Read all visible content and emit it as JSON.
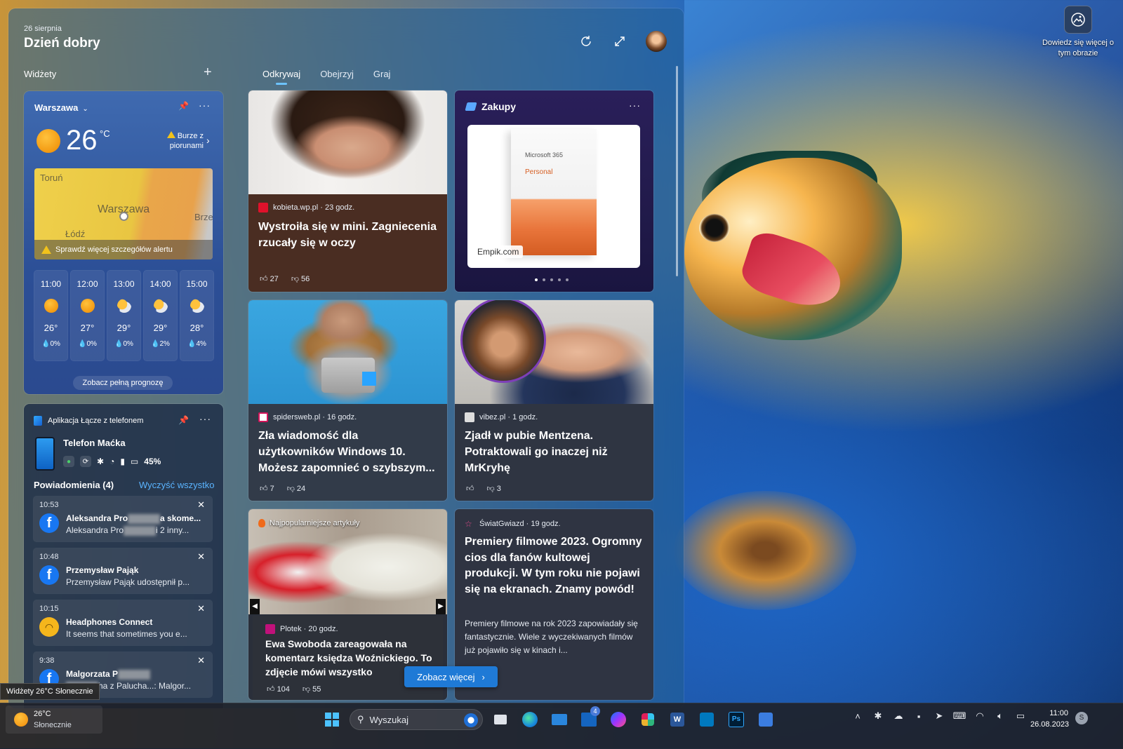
{
  "panel": {
    "date": "26 sierpnia",
    "greeting": "Dzień dobry",
    "widgets_label": "Widżety",
    "add_icon": "plus-icon",
    "tabs": [
      {
        "label": "Odkrywaj",
        "active": true
      },
      {
        "label": "Obejrzyj",
        "active": false
      },
      {
        "label": "Graj",
        "active": false
      }
    ]
  },
  "background": {
    "learn_more": "Dowiedz się więcej o tym obrazie"
  },
  "weather": {
    "city": "Warszawa",
    "temp": "26",
    "unit": "°C",
    "alert": "Burze z piorunami",
    "map_towns": [
      "Toruń",
      "Warszawa",
      "Łódź",
      "Brze"
    ],
    "map_alert": "Sprawdź więcej szczegółów alertu",
    "hourly": [
      {
        "time": "11:00",
        "temp": "26°",
        "rain": "0%",
        "icon": "sun"
      },
      {
        "time": "12:00",
        "temp": "27°",
        "rain": "0%",
        "icon": "sun"
      },
      {
        "time": "13:00",
        "temp": "29°",
        "rain": "0%",
        "icon": "sun-cloud"
      },
      {
        "time": "14:00",
        "temp": "29°",
        "rain": "2%",
        "icon": "sun-cloud"
      },
      {
        "time": "15:00",
        "temp": "28°",
        "rain": "4%",
        "icon": "sun-cloud"
      }
    ],
    "forecast_button": "Zobacz pełną prognozę"
  },
  "phone_link": {
    "title": "Aplikacja Łącze z telefonem",
    "device": "Telefon Maćka",
    "battery": "45%",
    "notifications_header": "Powiadomienia (4)",
    "clear_all": "Wyczyść wszystko",
    "notifications": [
      {
        "time": "10:53",
        "line1a": "Aleksandra Pro",
        "line1b": "a skome...",
        "line2a": "Aleksandra Pro",
        "line2b": "i 2 inny...",
        "app": "facebook"
      },
      {
        "time": "10:48",
        "line1a": "Przemysław Pająk",
        "line1b": "",
        "line2a": "Przemysław Pająk udostępnił p...",
        "line2b": "",
        "app": "facebook"
      },
      {
        "time": "10:15",
        "line1a": "Headphones Connect",
        "line1b": "",
        "line2a": "It seems that sometimes you e...",
        "line2b": "",
        "app": "headphones"
      },
      {
        "time": "9:38",
        "line1a": "Malgorzata P",
        "line1b": "",
        "line2a": "ha z Palucha...: Malgor...",
        "line2b": "",
        "app": "facebook"
      }
    ]
  },
  "tooltip": "Widżety 26°C Słonecznie",
  "news": {
    "c1": {
      "source": "kobieta.wp.pl · 23 godz.",
      "title": "Wystroiła się w mini. Zagniecenia rzucały się w oczy",
      "likes": "27",
      "dislikes": "56"
    },
    "c2": {
      "title": "Zakupy",
      "store": "Empik.com",
      "product_brand": "Microsoft 365",
      "product_name": "Personal"
    },
    "c3": {
      "source": "spidersweb.pl · 16 godz.",
      "title": "Zła wiadomość dla użytkowników Windows 10. Możesz zapomnieć o szybszym...",
      "likes": "7",
      "dislikes": "24"
    },
    "c4": {
      "source": "vibez.pl · 1 godz.",
      "title": "Zjadł w pubie Mentzena. Potraktowali go inaczej niż MrKryhę",
      "likes": "",
      "dislikes": "3"
    },
    "c5": {
      "badge": "Najpopularniejsze artykuły",
      "source": "Plotek · 20 godz.",
      "title": "Ewa Swoboda zareagowała na komentarz księdza Woźnickiego. To zdjęcie mówi wszystko",
      "likes": "104",
      "dislikes": "55"
    },
    "c6": {
      "source": "ŚwiatGwiazd · 19 godz.",
      "title": "Premiery filmowe 2023. Ogromny cios dla fanów kultowej produkcji. W tym roku nie pojawi się na ekranach. Znamy powód!",
      "summary": "Premiery filmowe na rok 2023 zapowiadały się fantastycznie. Wiele z wyczekiwanych filmów już pojawiło się w kinach i..."
    }
  },
  "see_more": "Zobacz więcej",
  "taskbar": {
    "weather_temp": "26°C",
    "weather_desc": "Słonecznie",
    "search_placeholder": "Wyszukaj",
    "mail_badge": "4",
    "time": "11:00",
    "date": "26.08.2023",
    "notif_count": "S"
  }
}
